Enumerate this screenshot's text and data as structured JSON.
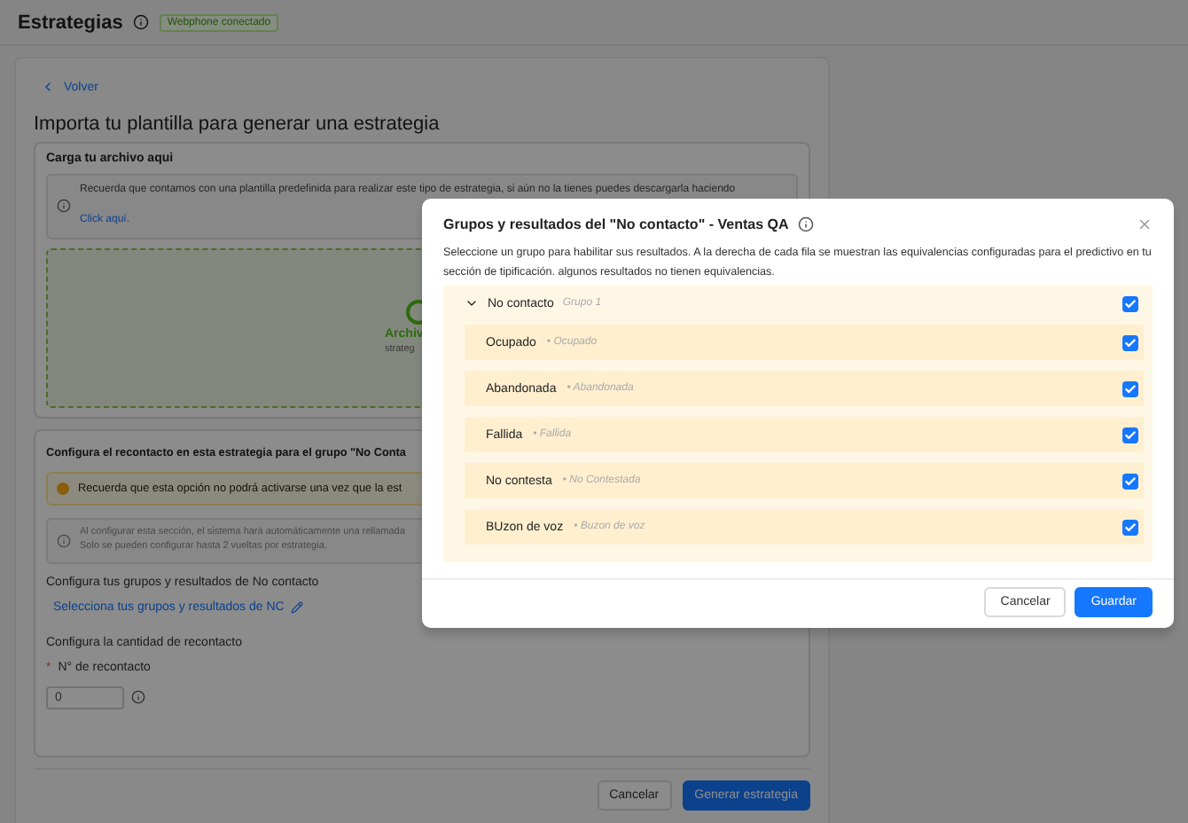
{
  "header": {
    "title": "Estrategias",
    "badge": "Webphone conectado"
  },
  "page": {
    "back_link": "Volver",
    "title": "Importa tu plantilla para generar una estrategia",
    "upload_section": {
      "title": "Carga tu archivo aqui",
      "notice": {
        "text": "Recuerda que contamos con una plantilla predefinida para realizar este tipo de estrategia, si aún no la tienes puedes descargarla haciendo",
        "link": "Click aquí."
      },
      "dropzone": {
        "text": "Archiv",
        "subtext": "strateg"
      }
    },
    "recontact_section": {
      "title": "Configura el recontacto en esta estrategia para el grupo \"No Conta",
      "warning": "Recuerda que esta opción no podrá activarse una vez que la est",
      "info": [
        "Al configurar esta sección, el sistema hará automáticamente una rellamada",
        "Solo se pueden configurar hasta 2 vueltas por estrategia."
      ],
      "groups_label": "Configura tus grupos y resultados de No contacto",
      "groups_link": "Selecciona tus grupos y resultados de NC",
      "quantity_label": "Configura la cantidad de recontacto",
      "field": {
        "required_mark": "*",
        "label": "N° de recontacto",
        "value": "0"
      }
    },
    "buttons": [
      {
        "label": "Cancelar",
        "kind": "secondary"
      },
      {
        "label": "Generar estrategia",
        "kind": "primary"
      }
    ]
  },
  "modal": {
    "title": "Grupos y resultados del \"No contacto\" - Ventas QA",
    "description": "Seleccione un grupo para habilitar sus resultados. A la derecha de cada fila se muestran las equivalencias configuradas para el predictivo en tu sección de tipificación. algunos resultados no tienen equivalencias.",
    "group": {
      "name": "No contacto",
      "tag": "Grupo 1",
      "expanded": true,
      "checked": true,
      "results": [
        {
          "name": "Ocupado",
          "equivalence": "• Ocupado",
          "checked": true
        },
        {
          "name": "Abandonada",
          "equivalence": "• Abandonada",
          "checked": true
        },
        {
          "name": "Fallida",
          "equivalence": "• Fallida",
          "checked": true
        },
        {
          "name": "No contesta",
          "equivalence": "• No Contestada",
          "checked": true
        },
        {
          "name": "BUzon de voz",
          "equivalence": "• Buzon de voz",
          "checked": true
        }
      ]
    },
    "buttons": [
      {
        "label": "Cancelar",
        "kind": "secondary"
      },
      {
        "label": "Guardar",
        "kind": "primary"
      }
    ]
  }
}
